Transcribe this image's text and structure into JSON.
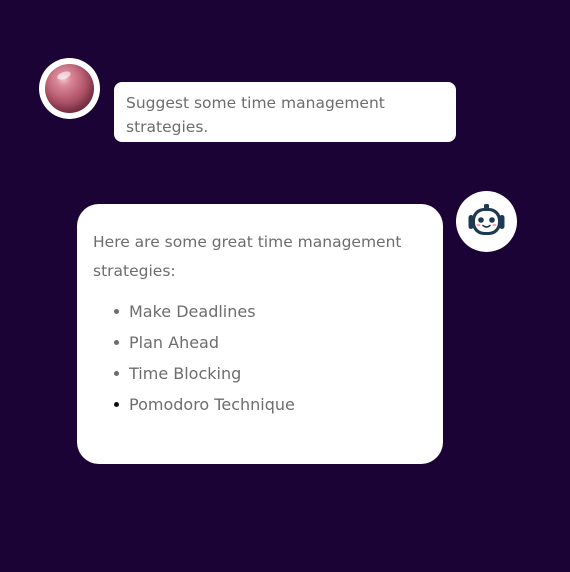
{
  "user_message": {
    "text": "Suggest some time management strategies."
  },
  "bot_message": {
    "intro": "Here are some great time management strategies:",
    "items": [
      "Make Deadlines",
      "Plan Ahead",
      "Time Blocking",
      "Pomodoro Technique"
    ]
  },
  "avatars": {
    "user": "pink-sphere-avatar-icon",
    "bot": "robot-head-icon"
  },
  "colors": {
    "background": "#1c0336",
    "bubble": "#ffffff",
    "text": "#6d6d6d"
  }
}
